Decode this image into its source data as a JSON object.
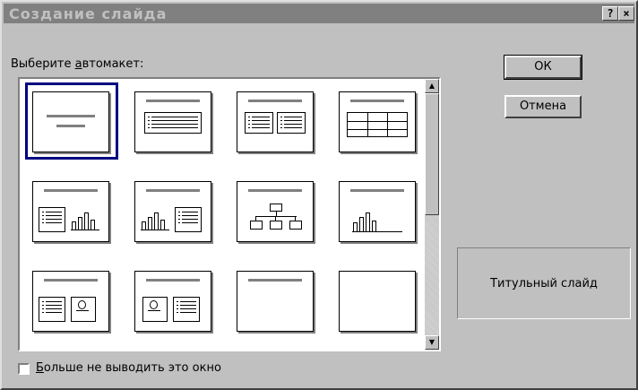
{
  "window": {
    "title": "Создание слайда",
    "help_glyph": "?",
    "close_glyph": "×"
  },
  "label_prefix": "Выберите ",
  "label_underlined": "а",
  "label_rest": "втомакет:",
  "buttons": {
    "ok": "ОК",
    "cancel": "Отмена"
  },
  "description": "Титульный слайд",
  "checkbox": {
    "checked": false,
    "label_underlined": "Б",
    "label_rest": "ольше не выводить это окно"
  },
  "layouts": [
    "title-slide",
    "bulleted-list",
    "two-column-text",
    "table",
    "text-and-chart",
    "chart-and-text",
    "organization-chart",
    "chart",
    "text-and-clip-art",
    "clip-art-and-text",
    "title-only",
    "blank"
  ],
  "selected_index": 0,
  "colors": {
    "titlebar": "#808080",
    "selection": "#000080",
    "face": "#c0c0c0"
  }
}
